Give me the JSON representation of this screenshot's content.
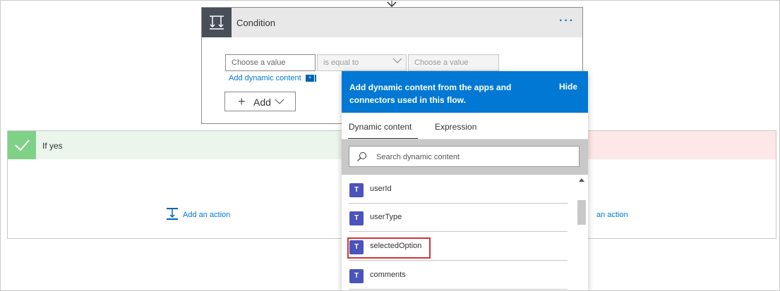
{
  "condition": {
    "title": "Condition",
    "more_label": "···",
    "value1_placeholder": "Choose a value",
    "operator": "is equal to",
    "value2_placeholder": "Choose a value",
    "add_dynamic_content": "Add dynamic content",
    "add_button": "Add"
  },
  "branches": {
    "yes_label": "If yes",
    "yes_add_action": "Add an action",
    "no_add_action_partial": "an action"
  },
  "dynamic_panel": {
    "description": "Add dynamic content from the apps and connectors used in this flow.",
    "hide": "Hide",
    "tabs": [
      {
        "label": "Dynamic content",
        "active": true
      },
      {
        "label": "Expression",
        "active": false
      }
    ],
    "search_placeholder": "Search dynamic content",
    "items": [
      {
        "label": "userId",
        "icon": "teams-icon"
      },
      {
        "label": "userType",
        "icon": "teams-icon"
      },
      {
        "label": "selectedOption",
        "icon": "teams-icon",
        "highlighted": true
      },
      {
        "label": "comments",
        "icon": "teams-icon"
      }
    ]
  },
  "colors": {
    "accent": "#0078d4",
    "yes_branch": "#7fd188",
    "no_branch": "#fde7e7",
    "highlight": "#d13438",
    "teams": "#4b53bc"
  }
}
